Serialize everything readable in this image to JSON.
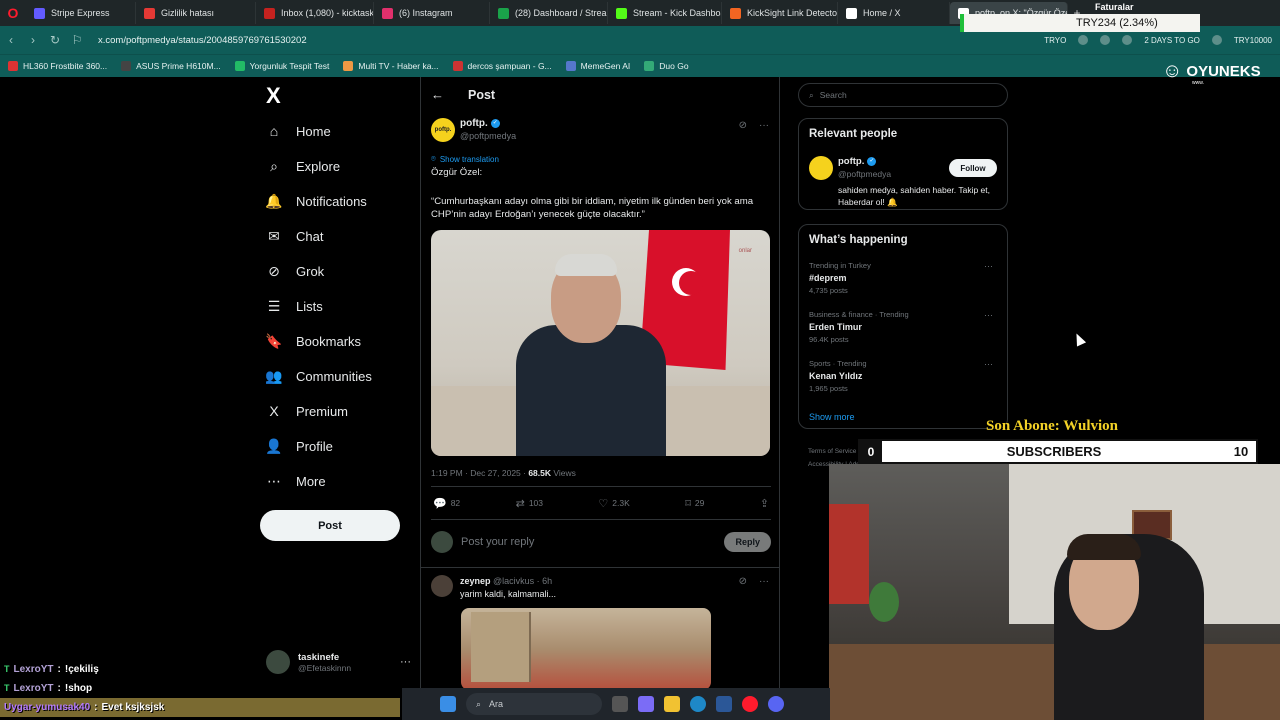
{
  "browser": {
    "tabs": [
      {
        "label": "Stripe Express",
        "color": "#635bff"
      },
      {
        "label": "Gizlilik hatası",
        "color": "#e53935"
      },
      {
        "label": "Inbox (1,080) - kicktaskine",
        "color": "#c5221f"
      },
      {
        "label": "(6) Instagram",
        "color": "#e1306c"
      },
      {
        "label": "(28) Dashboard / Streamla",
        "color": "#1aa34a"
      },
      {
        "label": "Stream - Kick Dashboard",
        "color": "#53fc18"
      },
      {
        "label": "KickSight Link Detector",
        "color": "#f26522"
      },
      {
        "label": "Home / X",
        "color": "#ffffff"
      },
      {
        "label": "poftp. on X: \"Özgür Özel",
        "color": "#ffffff"
      }
    ],
    "url": "x.com/poftpmedya/status/2004859769761530202",
    "addr_right_1": "TRYO",
    "addr_right_2": "2 DAYS TO GO",
    "addr_right_3": "TRY10000",
    "bookmarks": [
      "HL360 Frostbite 360...",
      "ASUS Prime H610M...",
      "Yorgunluk Tespit Test",
      "Multi TV - Haber ka...",
      "dercos şampuan - G...",
      "MemeGen AI",
      "Duo Go"
    ]
  },
  "x": {
    "logo": "X",
    "nav": [
      {
        "label": "Home",
        "icon": "home-icon",
        "glyph": "⌂"
      },
      {
        "label": "Explore",
        "icon": "search-icon",
        "glyph": "⌕"
      },
      {
        "label": "Notifications",
        "icon": "bell-icon",
        "glyph": "🔔"
      },
      {
        "label": "Chat",
        "icon": "mail-icon",
        "glyph": "✉"
      },
      {
        "label": "Grok",
        "icon": "grok-icon",
        "glyph": "⊘"
      },
      {
        "label": "Lists",
        "icon": "list-icon",
        "glyph": "☰"
      },
      {
        "label": "Bookmarks",
        "icon": "bookmark-icon",
        "glyph": "🔖"
      },
      {
        "label": "Communities",
        "icon": "people-icon",
        "glyph": "👥"
      },
      {
        "label": "Premium",
        "icon": "x-premium-icon",
        "glyph": "X"
      },
      {
        "label": "Profile",
        "icon": "person-icon",
        "glyph": "👤"
      },
      {
        "label": "More",
        "icon": "more-circle-icon",
        "glyph": "⋯"
      }
    ],
    "post_button": "Post",
    "account": {
      "name": "taskinefe",
      "handle": "@Efetaskinnn"
    },
    "header_title": "Post",
    "tweet": {
      "avatar_text": "poftp.",
      "name": "poftp.",
      "handle": "@poftpmedya",
      "show_translation": "Show translation",
      "line1": "Özgür Özel:",
      "line2": "“Cumhurbaşkanı adayı olma gibi bir iddiam, niyetim ilk günden beri yok ama CHP’nin adayı Erdoğan’ı yenecek güçte olacaktır.”",
      "image_watermark": "onlar",
      "time": "1:19 PM · Dec 27, 2025 · ",
      "views_count": "68.5K",
      "views_label": " Views",
      "replies": "82",
      "reposts": "103",
      "likes": "2.3K",
      "bookmarks": "29"
    },
    "reply_placeholder": "Post your reply",
    "reply_button": "Reply",
    "reply": {
      "name": "zeynep",
      "meta": " @lacivkus · 6h",
      "text": "yarim kaldi, kalmamali..."
    },
    "search_placeholder": "Search",
    "relevant_people": {
      "title": "Relevant people",
      "name": "poftp.",
      "handle": "@poftpmedya",
      "bio": "sahiden medya, sahiden haber. Takip et, Haberdar ol! 🔔",
      "follow": "Follow"
    },
    "whats_happening": {
      "title": "What’s happening",
      "trends": [
        {
          "context": "Trending in Turkey",
          "name": "#deprem",
          "posts": "4,735 posts"
        },
        {
          "context": "Business & finance · Trending",
          "name": "Erden Timur",
          "posts": "96.4K posts"
        },
        {
          "context": "Sports · Trending",
          "name": "Kenan Yıldız",
          "posts": "1,965 posts"
        }
      ],
      "show_more": "Show more"
    },
    "footer": "Terms of Service | Privacy Policy | Cookie Policy | Imprint | Accessibility | Ads info | More ··· © 2025 X Corp."
  },
  "overlay": {
    "brand": "OYUNEKS",
    "brand_sub": "www.",
    "ticker_title": "Faturalar",
    "ticker_value": "TRY234 (2.34%)",
    "latest_sub": "Son Abone: Wulvion",
    "sub_start": "0",
    "sub_label": "SUBSCRIBERS",
    "sub_goal": "10",
    "chat": [
      {
        "user": "LexroYT",
        "msg": "!çekiliş"
      },
      {
        "user": "LexroYT",
        "msg": "!shop"
      },
      {
        "user": "Uygar-yumusak40",
        "msg": "Evet ksjksjsk"
      }
    ],
    "taskbar_search": "Ara"
  }
}
